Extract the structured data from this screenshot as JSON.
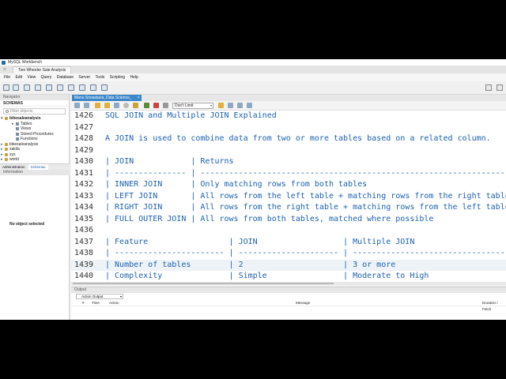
{
  "window": {
    "title": "MySQL Workbench"
  },
  "connection_tab": {
    "label": "Two Wheeler Sale Analysis"
  },
  "menu": [
    "File",
    "Edit",
    "View",
    "Query",
    "Database",
    "Server",
    "Tools",
    "Scripting",
    "Help"
  ],
  "navigator": {
    "header": "Navigator",
    "schemas_label": "SCHEMAS",
    "filter_placeholder": "Filter objects",
    "tree": [
      {
        "name": "bikesaleanalysis",
        "bold": true,
        "expanded": true,
        "children": [
          "Tables",
          "Views",
          "Stored Procedures",
          "Functions"
        ]
      },
      {
        "name": "bikesaleanalysis",
        "bold": false
      },
      {
        "name": "sakila",
        "bold": false
      },
      {
        "name": "sys",
        "bold": false
      },
      {
        "name": "world",
        "bold": false
      }
    ],
    "tabs": [
      "Administration",
      "Schemas"
    ],
    "info_header": "Information",
    "no_object": "No object selected"
  },
  "editor": {
    "tab_label": "Manu Srivastava_Data Science_",
    "limit_label": "Don't Limit",
    "lines": [
      {
        "no": "1426",
        "text": "SQL JOIN and Multiple JOIN Explained"
      },
      {
        "no": "1427",
        "text": ""
      },
      {
        "no": "1428",
        "text": "A JOIN is used to combine data from two or more tables based on a related column."
      },
      {
        "no": "1429",
        "text": ""
      },
      {
        "no": "1430",
        "text": "| JOIN            | Returns                                                           |"
      },
      {
        "no": "1431",
        "text": "| --------------- | ----------------------------------------------------------------- |"
      },
      {
        "no": "1432",
        "text": "| INNER JOIN      | Only matching rows from both tables                               |"
      },
      {
        "no": "1433",
        "text": "| LEFT JOIN       | All rows from the left table + matching rows from the right table |"
      },
      {
        "no": "1434",
        "text": "| RIGHT JOIN      | All rows from the right table + matching rows from the left table |"
      },
      {
        "no": "1435",
        "text": "| FULL OUTER JOIN | All rows from both tables, matched where possible                 |"
      },
      {
        "no": "1436",
        "text": ""
      },
      {
        "no": "1437",
        "text": "| Feature                 | JOIN                  | Multiple JOIN                       |"
      },
      {
        "no": "1438",
        "text": "| ----------------------- | --------------------- | ----------------------------------- |"
      },
      {
        "no": "1439",
        "text": "| Number of tables        | 2                     | 3 or more"
      },
      {
        "no": "1440",
        "text": "| Complexity              | Simple                | Moderate to High"
      }
    ]
  },
  "output": {
    "header": "Output",
    "select_label": "Action Output",
    "columns": [
      "#",
      "Time",
      "Action",
      "Message",
      "Duration / Fetch"
    ]
  }
}
